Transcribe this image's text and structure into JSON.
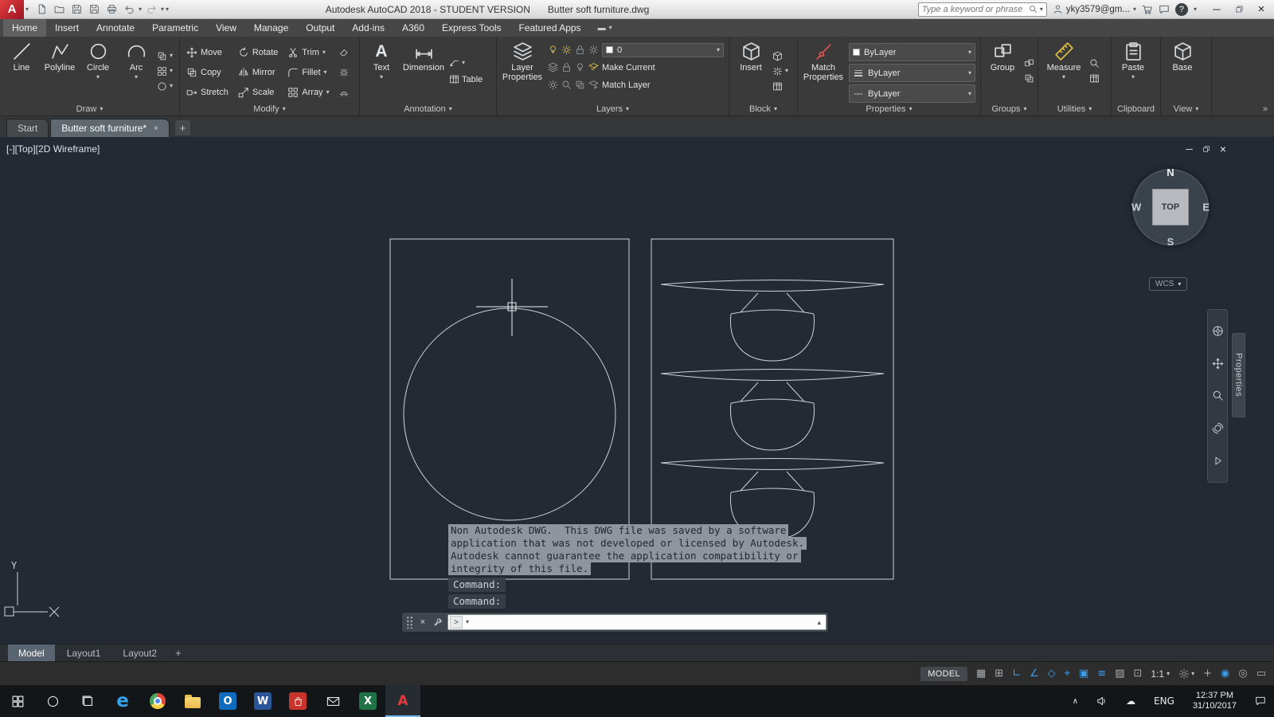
{
  "titlebar": {
    "app_title": "Autodesk AutoCAD 2018 - STUDENT VERSION",
    "file_name": "Butter soft furniture.dwg",
    "search_placeholder": "Type a keyword or phrase",
    "account_name": "yky3579@gm..."
  },
  "ribbon": {
    "tabs": [
      "Home",
      "Insert",
      "Annotate",
      "Parametric",
      "View",
      "Manage",
      "Output",
      "Add-ins",
      "A360",
      "Express Tools",
      "Featured Apps"
    ],
    "panels": {
      "draw": {
        "label": "Draw",
        "line": "Line",
        "polyline": "Polyline",
        "circle": "Circle",
        "arc": "Arc"
      },
      "modify": {
        "label": "Modify",
        "move": "Move",
        "rotate": "Rotate",
        "trim": "Trim",
        "copy": "Copy",
        "mirror": "Mirror",
        "fillet": "Fillet",
        "stretch": "Stretch",
        "scale": "Scale",
        "array": "Array"
      },
      "annotation": {
        "label": "Annotation",
        "text": "Text",
        "dimension": "Dimension",
        "table": "Table"
      },
      "layers": {
        "label": "Layers",
        "layer_properties": "Layer Properties",
        "current_layer": "0",
        "make_current": "Make Current",
        "match_layer": "Match Layer"
      },
      "block": {
        "label": "Block",
        "insert": "Insert"
      },
      "properties": {
        "label": "Properties",
        "match_properties": "Match Properties",
        "color": "ByLayer",
        "lineweight": "ByLayer",
        "linetype": "ByLayer"
      },
      "groups": {
        "label": "Groups",
        "group": "Group"
      },
      "utilities": {
        "label": "Utilities",
        "measure": "Measure"
      },
      "clipboard": {
        "label": "Clipboard",
        "paste": "Paste"
      },
      "view": {
        "label": "View",
        "base": "Base"
      }
    }
  },
  "file_tabs": {
    "start": "Start",
    "active_drawing": "Butter soft furniture*"
  },
  "viewport": {
    "label": "[-][Top][2D Wireframe]",
    "viewcube": {
      "north": "N",
      "south": "S",
      "east": "E",
      "west": "W",
      "face": "TOP"
    },
    "wcs": "WCS",
    "ucs_axis": "Y",
    "properties_palette": "Properties"
  },
  "command_line": {
    "warning_lines": [
      "Non Autodesk DWG.  This DWG file was saved by a software",
      "application that was not developed or licensed by Autodesk.",
      "Autodesk cannot guarantee the application compatibility or",
      "integrity of this file."
    ],
    "prompt_1": "Command:",
    "prompt_2": "Command:"
  },
  "layout_tabs": {
    "model": "Model",
    "layout1": "Layout1",
    "layout2": "Layout2"
  },
  "status_bar": {
    "model_space": "MODEL",
    "annotation_scale": "1:1"
  },
  "taskbar": {
    "language": "ENG",
    "time": "12:37 PM",
    "date": "31/10/2017"
  },
  "icons": {
    "logo": "A",
    "help": "?",
    "minimize": "─",
    "close": "×",
    "plus": "+",
    "collapse": "»",
    "ribbon_pin": "▬",
    "prompt": ">",
    "expand": "▴",
    "hidden_icons": "∧",
    "cloud": "☁",
    "text_tool": "A",
    "grid": "▦",
    "snap": "⊞",
    "ortho": "∟",
    "polar": "∠",
    "isodraft": "◇",
    "osnap_tracking": "⌖",
    "osnap": "▣",
    "lineweight": "≡",
    "transparency": "▨",
    "selection_cycling": "⊡",
    "hardware": "◉",
    "isolate": "◎",
    "clean_screen": "▭",
    "edge": "e",
    "word": "W",
    "excel": "X",
    "outlook": "O",
    "autocad": "A"
  },
  "colors": {
    "canvas_background": "#232a33",
    "accent_blue": "#3d9be9",
    "autocad_red": "#c21d2c",
    "ribbon_background": "#3a3a3a",
    "taskbar_background": "#131619"
  }
}
